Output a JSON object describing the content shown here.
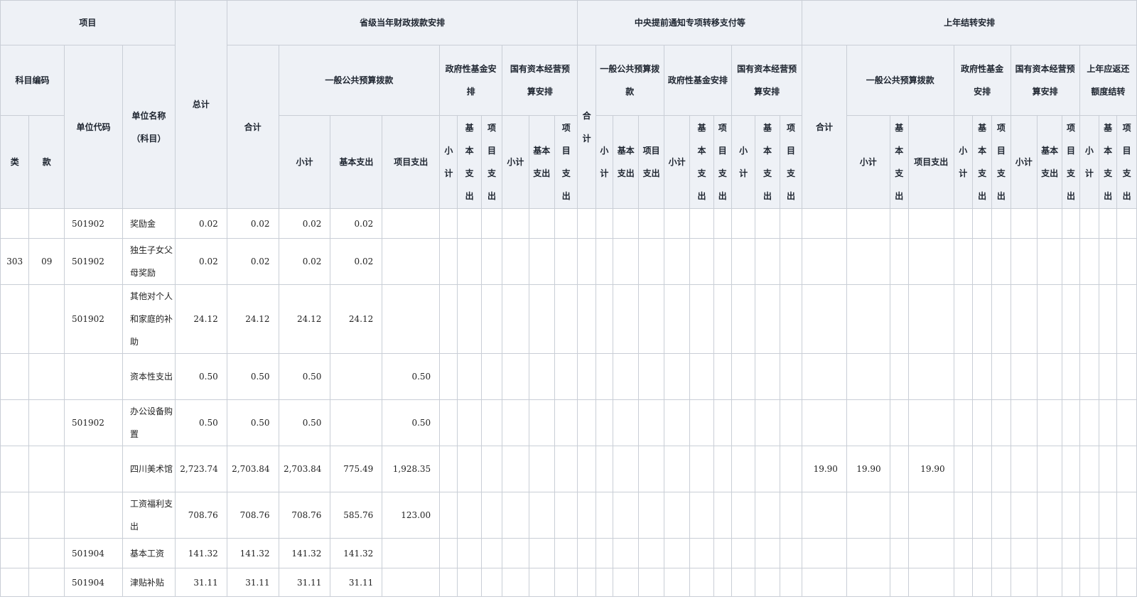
{
  "header": {
    "project": "项目",
    "subject_code": "科目编码",
    "unit_code": "单位代码",
    "unit_name": "单位名称（科目）",
    "total": "总计",
    "lei": "类",
    "kuan": "款",
    "groups": {
      "provincial": "省级当年财政拨款安排",
      "central": "中央提前通知专项转移支付等",
      "carryover": "上年结转安排"
    },
    "prov": {
      "subtotal": "合计",
      "general": "一般公共预算拨款",
      "gov_fund": "政府性基金安排",
      "state_cap": "国有资本经营预算安排",
      "small_total": "小计",
      "basic": "基本支出",
      "project": "项目支出",
      "small_total_v": "小计",
      "basic_v": "基本支出",
      "project_v": "项目支出"
    },
    "central": {
      "total": "合计",
      "general": "一般公共预算拨款",
      "gov_fund": "政府性基金安排",
      "state_cap": "国有资本经营预算安排",
      "small_total_v": "小计",
      "basic_v": "基本支出",
      "project_v": "项目支出"
    },
    "carry": {
      "total": "合计",
      "general": "一般公共预算拨款",
      "gov_fund": "政府性基金安排",
      "state_cap": "国有资本经营预算安排",
      "return_quota": "上年应返还额度结转",
      "small_total": "小计",
      "basic_v": "基本支出",
      "project": "项目支出",
      "small_total_v": "小计",
      "project_v": "项目支出"
    }
  },
  "rows": [
    {
      "lei": "",
      "kuan": "",
      "code": "501902",
      "name": "奖励金",
      "total": "0.02",
      "p_sum": "0.02",
      "p_small": "0.02",
      "p_basic": "0.02",
      "p_project": "",
      "c_total": "",
      "c_small": "",
      "c_project": "",
      "h": 42
    },
    {
      "lei": "303",
      "kuan": "09",
      "code": "501902",
      "name": "独生子女父母奖励",
      "total": "0.02",
      "p_sum": "0.02",
      "p_small": "0.02",
      "p_basic": "0.02",
      "p_project": "",
      "c_total": "",
      "c_small": "",
      "c_project": "",
      "h": 65
    },
    {
      "lei": "",
      "kuan": "",
      "code": "501902",
      "name": "其他对个人和家庭的补助",
      "total": "24.12",
      "p_sum": "24.12",
      "p_small": "24.12",
      "p_basic": "24.12",
      "p_project": "",
      "c_total": "",
      "c_small": "",
      "c_project": "",
      "h": 97
    },
    {
      "lei": "",
      "kuan": "",
      "code": "",
      "name": "资本性支出",
      "total": "0.50",
      "p_sum": "0.50",
      "p_small": "0.50",
      "p_basic": "",
      "p_project": "0.50",
      "c_total": "",
      "c_small": "",
      "c_project": "",
      "h": 65
    },
    {
      "lei": "",
      "kuan": "",
      "code": "501902",
      "name": "办公设备购置",
      "total": "0.50",
      "p_sum": "0.50",
      "p_small": "0.50",
      "p_basic": "",
      "p_project": "0.50",
      "c_total": "",
      "c_small": "",
      "c_project": "",
      "h": 65
    },
    {
      "lei": "",
      "kuan": "",
      "code": "",
      "name": "四川美术馆",
      "total": "2,723.74",
      "p_sum": "2,703.84",
      "p_small": "2,703.84",
      "p_basic": "775.49",
      "p_project": "1,928.35",
      "c_total": "19.90",
      "c_small": "19.90",
      "c_project": "19.90",
      "h": 65
    },
    {
      "lei": "",
      "kuan": "",
      "code": "",
      "name": "工资福利支出",
      "total": "708.76",
      "p_sum": "708.76",
      "p_small": "708.76",
      "p_basic": "585.76",
      "p_project": "123.00",
      "c_total": "",
      "c_small": "",
      "c_project": "",
      "h": 65
    },
    {
      "lei": "",
      "kuan": "",
      "code": "501904",
      "name": "基本工资",
      "total": "141.32",
      "p_sum": "141.32",
      "p_small": "141.32",
      "p_basic": "141.32",
      "p_project": "",
      "c_total": "",
      "c_small": "",
      "c_project": "",
      "h": 42
    },
    {
      "lei": "",
      "kuan": "",
      "code": "501904",
      "name": "津贴补贴",
      "total": "31.11",
      "p_sum": "31.11",
      "p_small": "31.11",
      "p_basic": "31.11",
      "p_project": "",
      "c_total": "",
      "c_small": "",
      "c_project": "",
      "h": 40
    }
  ]
}
